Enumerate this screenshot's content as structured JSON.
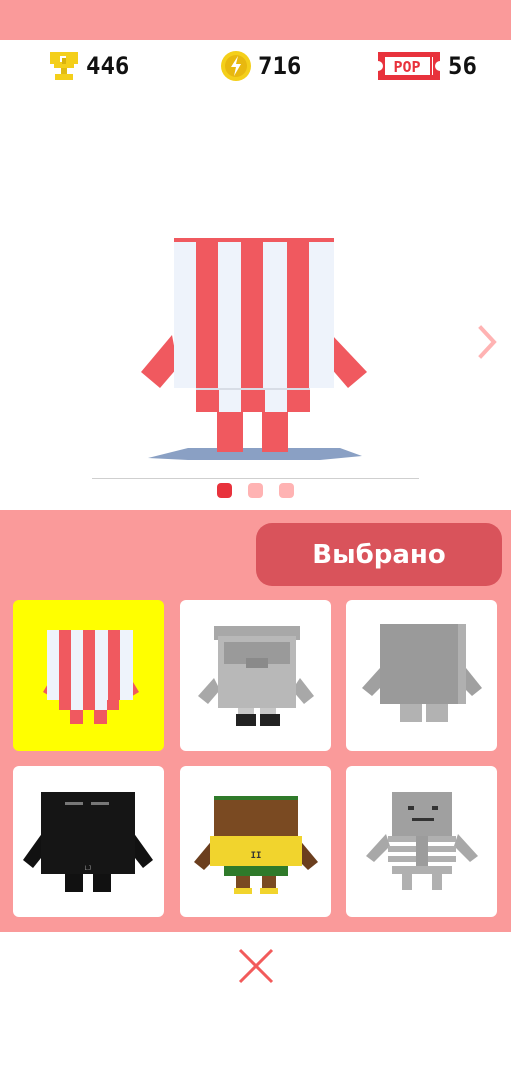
{
  "stats": {
    "trophies": {
      "icon": "trophy-icon",
      "value": "446"
    },
    "coins": {
      "icon": "coin-icon",
      "value": "716"
    },
    "pop": {
      "icon": "pop-ticket-icon",
      "ticket_text": "POP",
      "value": "56"
    }
  },
  "preview": {
    "character": "popcorn-box-character",
    "next_icon": "chevron-right-icon",
    "pages": {
      "count": 3,
      "active": 0
    }
  },
  "panel": {
    "select_button_label": "Выбрано",
    "characters": [
      {
        "name": "popcorn-box",
        "selected": true
      },
      {
        "name": "gray-robot",
        "selected": false
      },
      {
        "name": "gray-box",
        "selected": false
      },
      {
        "name": "black-cube",
        "selected": false,
        "badge": "LJ"
      },
      {
        "name": "burger",
        "selected": false,
        "badge": "II"
      },
      {
        "name": "skeleton",
        "selected": false
      }
    ]
  },
  "close_icon": "close-x-icon",
  "colors": {
    "topbar": "#fa9a9a",
    "panel": "#fa9a9a",
    "button": "#d9535b",
    "selected_card": "#ffff00",
    "stripe_red": "#f0595f",
    "gold": "#f4cf1a",
    "ticket_red": "#e8323c"
  }
}
